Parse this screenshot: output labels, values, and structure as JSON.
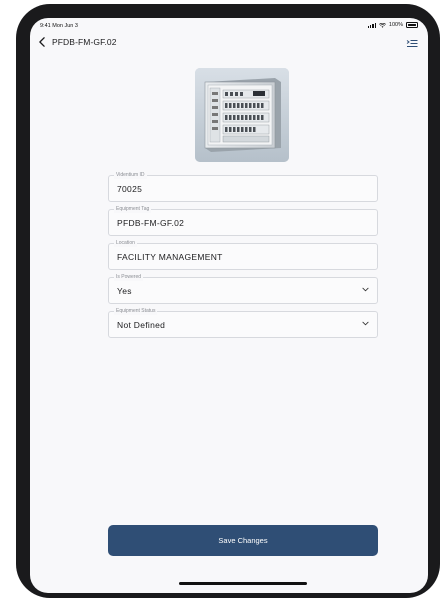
{
  "status_bar": {
    "time": "9:41 Mon Jun 3",
    "battery": "100%"
  },
  "nav": {
    "title": "PFDB-FM-GF.02"
  },
  "fields": {
    "videntium_id": {
      "label": "Videntium ID",
      "value": "70025"
    },
    "equipment_tag": {
      "label": "Equipment Tag",
      "value": "PFDB-FM-GF.02"
    },
    "location": {
      "label": "Location",
      "value": "FACILITY MANAGEMENT"
    },
    "is_powered": {
      "label": "Is Powered",
      "value": "Yes"
    },
    "equipment_status": {
      "label": "Equipment Status",
      "value": "Not Defined"
    }
  },
  "actions": {
    "save_label": "Save Changes"
  },
  "colors": {
    "primary": "#2f4e75",
    "background": "#f8f8fa",
    "border": "#d7d9de"
  },
  "icons": {
    "back": "chevron-left-icon",
    "menu": "list-menu-icon",
    "dropdown": "chevron-down-icon"
  }
}
